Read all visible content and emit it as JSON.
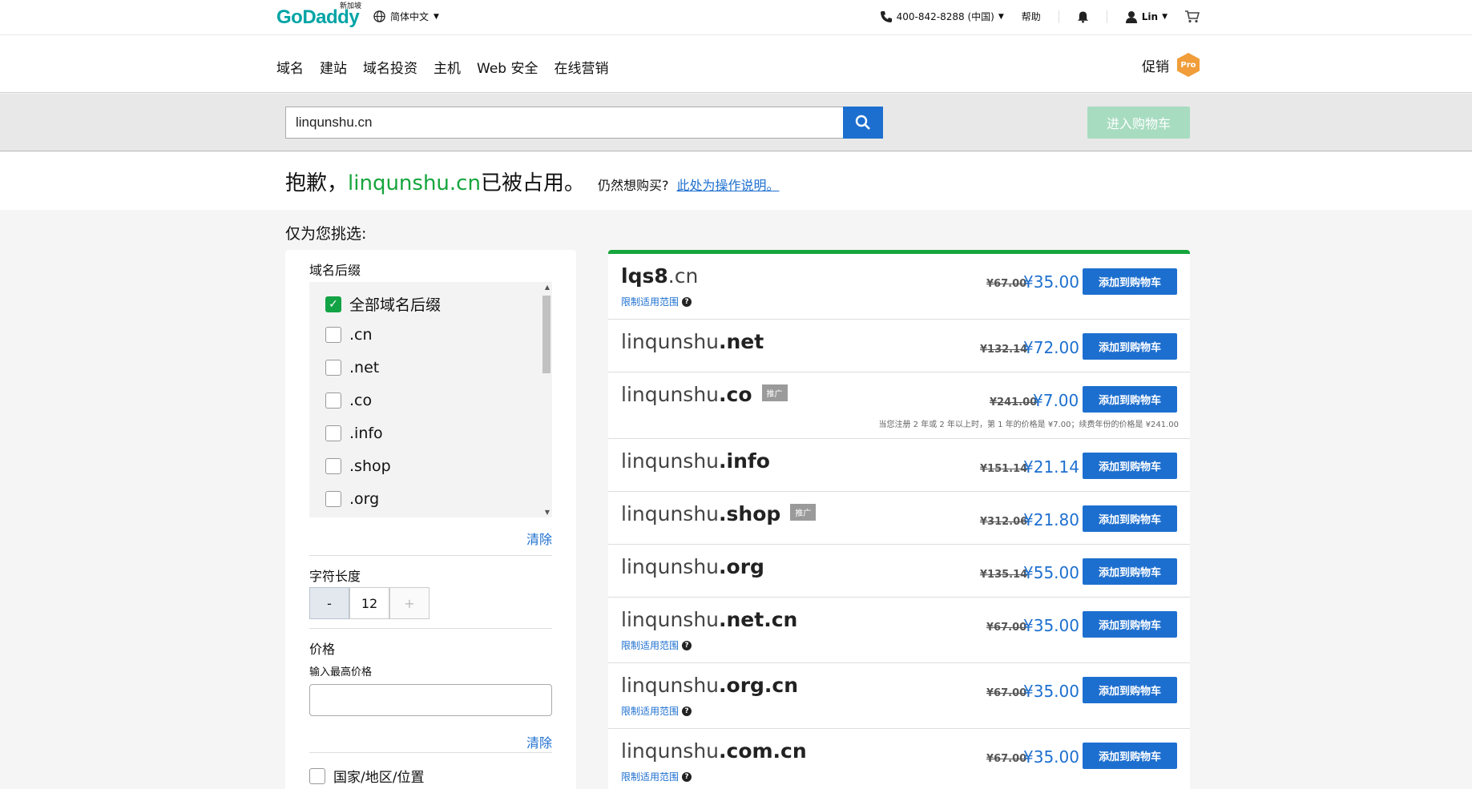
{
  "header": {
    "logo_text": "GoDaddy",
    "logo_sub": "新加坡",
    "language": "简体中文",
    "phone": "400-842-8288 (中国)",
    "help": "帮助",
    "user": "Lin"
  },
  "nav": {
    "items": [
      "域名",
      "建站",
      "域名投资",
      "主机",
      "Web 安全",
      "在线营销"
    ],
    "promo": "促销",
    "pro_badge": "Pro"
  },
  "search": {
    "value": "linqunshu.cn",
    "cart_button": "进入购物车"
  },
  "notice": {
    "prefix": "抱歉，",
    "domain": "linqunshu.cn",
    "suffix": " 已被占用。",
    "still_buy": "仍然想购买?",
    "link": "此处为操作说明。"
  },
  "picked_label": "仅为您挑选:",
  "filters": {
    "tld_title": "域名后缀",
    "tlds": [
      {
        "label": "全部域名后缀",
        "checked": true
      },
      {
        "label": ".cn",
        "checked": false
      },
      {
        "label": ".net",
        "checked": false
      },
      {
        "label": ".co",
        "checked": false
      },
      {
        "label": ".info",
        "checked": false
      },
      {
        "label": ".shop",
        "checked": false
      },
      {
        "label": ".org",
        "checked": false
      }
    ],
    "clear": "清除",
    "length_title": "字符长度",
    "length_minus": "-",
    "length_value": "12",
    "length_plus": "+",
    "price_title": "价格",
    "price_sub": "输入最高价格",
    "price_value": "",
    "clear2": "清除",
    "country": "国家/地区/位置"
  },
  "results": [
    {
      "base": "lqs8",
      "tld": ".cn",
      "bold_base": true,
      "old": "¥67.00",
      "new": "¥35.00",
      "limit": "限制适用范围",
      "tag": "",
      "note": ""
    },
    {
      "base": "linqunshu",
      "tld": ".net",
      "bold_base": false,
      "old": "¥132.14",
      "new": "¥72.00",
      "limit": "",
      "tag": "",
      "note": ""
    },
    {
      "base": "linqunshu",
      "tld": ".co",
      "bold_base": false,
      "old": "¥241.00",
      "new": "¥7.00",
      "limit": "",
      "tag": "推广",
      "note": "当您注册 2 年或 2 年以上时，第 1 年的价格是 ¥7.00；续费年份的价格是 ¥241.00"
    },
    {
      "base": "linqunshu",
      "tld": ".info",
      "bold_base": false,
      "old": "¥151.14",
      "new": "¥21.14",
      "limit": "",
      "tag": "",
      "note": ""
    },
    {
      "base": "linqunshu",
      "tld": ".shop",
      "bold_base": false,
      "old": "¥312.06",
      "new": "¥21.80",
      "limit": "",
      "tag": "推广",
      "note": ""
    },
    {
      "base": "linqunshu",
      "tld": ".org",
      "bold_base": false,
      "old": "¥135.14",
      "new": "¥55.00",
      "limit": "",
      "tag": "",
      "note": ""
    },
    {
      "base": "linqunshu",
      "tld": ".net.cn",
      "bold_base": false,
      "old": "¥67.00",
      "new": "¥35.00",
      "limit": "限制适用范围",
      "tag": "",
      "note": ""
    },
    {
      "base": "linqunshu",
      "tld": ".org.cn",
      "bold_base": false,
      "old": "¥67.00",
      "new": "¥35.00",
      "limit": "限制适用范围",
      "tag": "",
      "note": ""
    },
    {
      "base": "linqunshu",
      "tld": ".com.cn",
      "bold_base": false,
      "old": "¥67.00",
      "new": "¥35.00",
      "limit": "限制适用范围",
      "tag": "",
      "note": ""
    }
  ],
  "add_to_cart": "添加到购物车",
  "colors": {
    "brand": "#1bdbdb",
    "accent": "#1d6fcf",
    "success": "#15a53c"
  }
}
